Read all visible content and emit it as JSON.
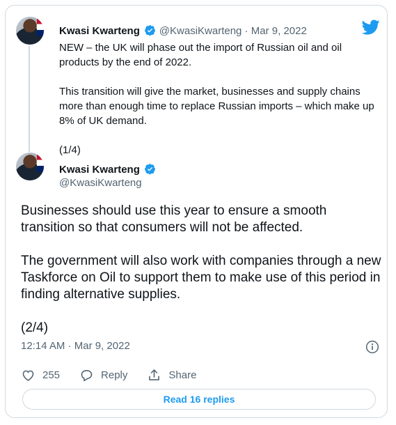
{
  "parent_tweet": {
    "author_name": "Kwasi Kwarteng",
    "author_handle": "@KwasiKwarteng",
    "separator": " · ",
    "date": "Mar 9, 2022",
    "paragraphs": [
      "NEW – the UK will phase out the import of Russian oil and oil products by the end of 2022.",
      "This transition will give the market, businesses and supply chains more than enough time to replace Russian imports – which make up 8% of UK demand.",
      "(1/4)"
    ]
  },
  "main_tweet": {
    "author_name": "Kwasi Kwarteng",
    "author_handle": "@KwasiKwarteng",
    "paragraphs": [
      "Businesses should use this year to ensure a smooth transition so that consumers will not be affected.",
      "The government will also work with companies through a new Taskforce on Oil to support them to make use of this period in finding alternative supplies.",
      "(2/4)"
    ],
    "time": "12:14 AM",
    "meta_separator": " · ",
    "date": "Mar 9, 2022"
  },
  "actions": {
    "like_count": "255",
    "reply_label": "Reply",
    "share_label": "Share"
  },
  "read_replies_label": "Read 16 replies",
  "colors": {
    "accent": "#1d9bf0",
    "secondary_text": "#536471",
    "border": "#cfd9de"
  },
  "icons": [
    "twitter-logo-icon",
    "verified-badge-icon",
    "info-icon",
    "heart-icon",
    "reply-icon",
    "share-icon"
  ]
}
